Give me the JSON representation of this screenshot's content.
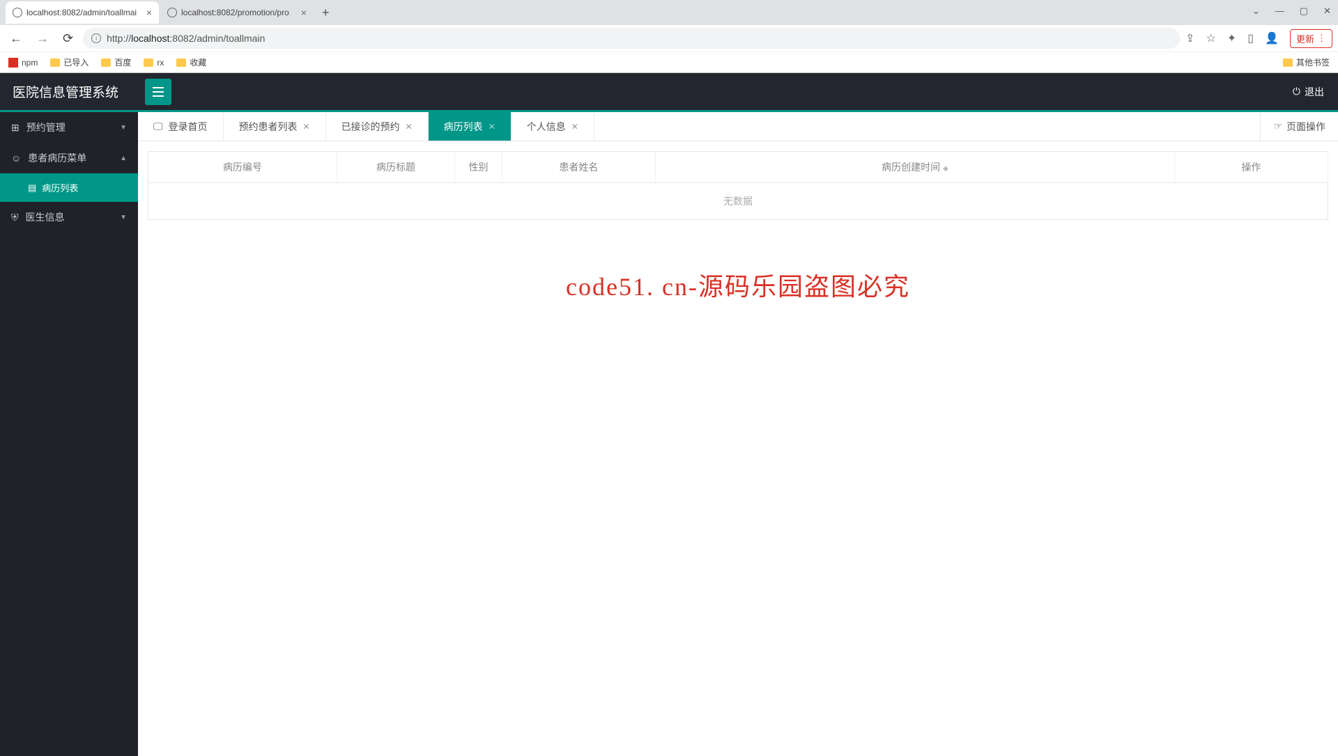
{
  "browser": {
    "tabs": [
      {
        "title": "localhost:8082/admin/toallmai",
        "active": true
      },
      {
        "title": "localhost:8082/promotion/pro",
        "active": false
      }
    ],
    "url_prefix": "http://",
    "url_host": "localhost",
    "url_path": ":8082/admin/toallmain",
    "update_label": "更新",
    "other_bookmarks": "其他书签",
    "bookmarks": [
      {
        "label": "npm",
        "type": "app"
      },
      {
        "label": "已导入",
        "type": "folder"
      },
      {
        "label": "百度",
        "type": "folder"
      },
      {
        "label": "rx",
        "type": "folder"
      },
      {
        "label": "收藏",
        "type": "folder"
      }
    ]
  },
  "app": {
    "title": "医院信息管理系统",
    "logout": "退出",
    "page_ops": "页面操作",
    "sidebar": [
      {
        "label": "预约管理",
        "icon": "grid",
        "expanded": false
      },
      {
        "label": "患者病历菜单",
        "icon": "user",
        "expanded": true,
        "children": [
          {
            "label": "病历列表"
          }
        ]
      },
      {
        "label": "医生信息",
        "icon": "shield",
        "expanded": false
      }
    ],
    "tabs": [
      {
        "label": "登录首页",
        "icon": true,
        "closable": false
      },
      {
        "label": "预约患者列表",
        "closable": true
      },
      {
        "label": "已接诊的预约",
        "closable": true
      },
      {
        "label": "病历列表",
        "closable": true,
        "active": true
      },
      {
        "label": "个人信息",
        "closable": true
      }
    ],
    "table": {
      "columns": [
        "病历编号",
        "病历标题",
        "性别",
        "患者姓名",
        "病历创建时间",
        "操作"
      ],
      "empty": "无数据",
      "sortable_col": 4
    }
  },
  "watermark": "code51. cn-源码乐园盗图必究"
}
